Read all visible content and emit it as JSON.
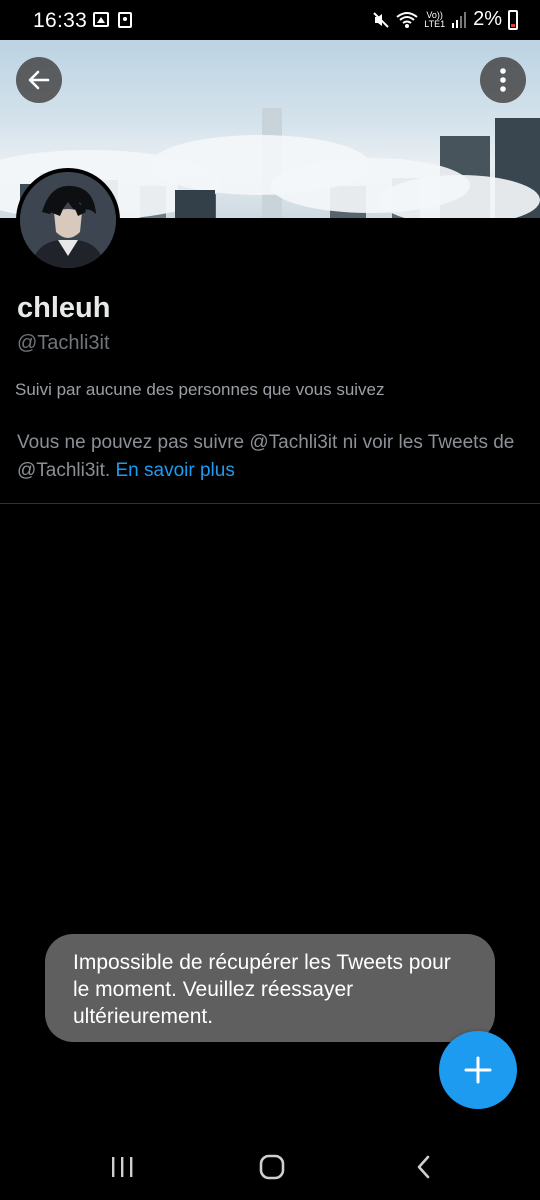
{
  "status_bar": {
    "time": "16:33",
    "battery": "2%",
    "network_top": "Vo))",
    "network_bottom": "LTE1"
  },
  "header": {
    "back_icon": "arrow-left-icon",
    "menu_icon": "more-vertical-icon"
  },
  "profile": {
    "name": "chleuh",
    "handle": "@Tachli3it",
    "followed_by": "Suivi par aucune des personnes que vous suivez",
    "notice_text": "Vous ne pouvez pas suivre @Tachli3it ni voir les Tweets de @Tachli3it. ",
    "notice_link": "En savoir plus"
  },
  "toast": {
    "message": "Impossible de récupérer les Tweets pour le moment. Veuillez réessayer ultérieurement."
  },
  "fab": {
    "icon": "plus-icon"
  },
  "colors": {
    "accent": "#1d9bf0",
    "background": "#000000",
    "text": "#e7e9ea",
    "secondary_text": "#71767b",
    "toast_bg": "#5f5f5f"
  },
  "nav": {
    "recent_icon": "recent-apps-icon",
    "home_icon": "home-icon",
    "back_icon": "back-chevron-icon"
  }
}
